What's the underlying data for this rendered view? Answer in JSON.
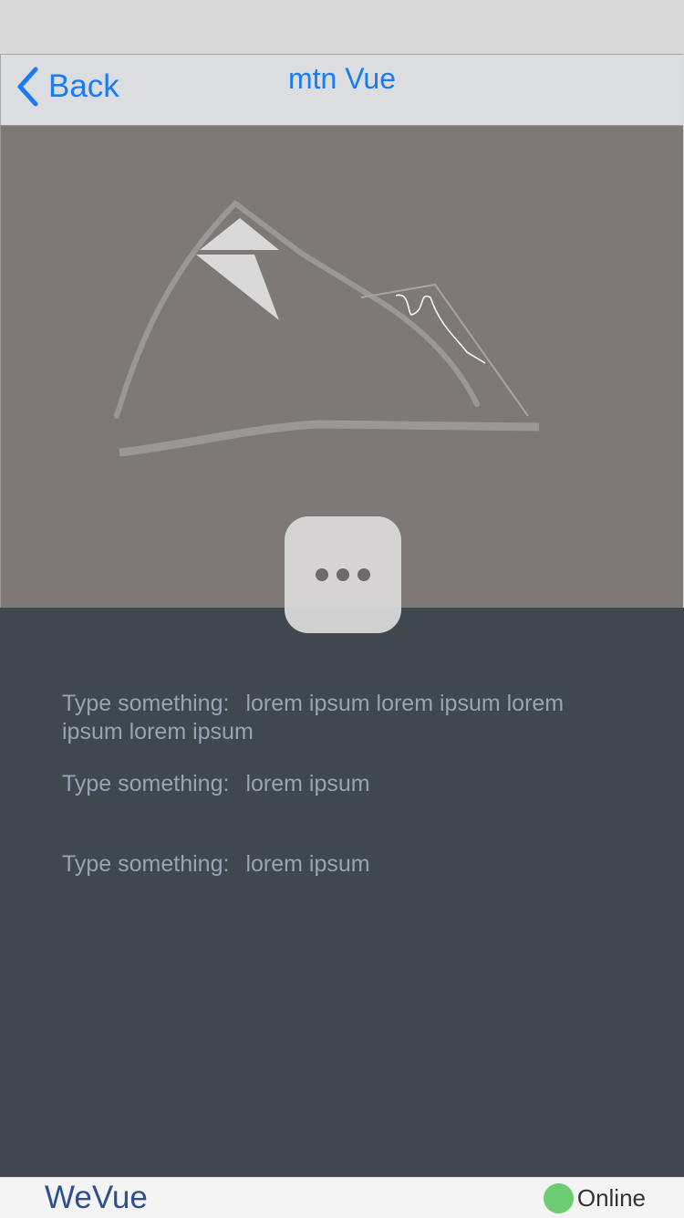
{
  "app": {
    "brand": "WeVue",
    "status_label": "Online",
    "colors": {
      "accent": "#1a7cf4",
      "brand": "#2d4f93",
      "online": "#6dcc72",
      "content_bg": "#3f474f"
    }
  },
  "nav": {
    "back_label": "Back",
    "back_icon": "chevron-left-icon",
    "title": "mtn Vue"
  },
  "hero": {
    "image": "mountain-sketch",
    "more_icon": "ellipsis-icon"
  },
  "details": [
    {
      "label": "Type something:",
      "value": "lorem ipsum lorem ipsum lorem ipsum lorem ipsum"
    },
    {
      "label": "Type something:",
      "value": "lorem ipsum"
    },
    {
      "label": "Type something:",
      "value": "lorem ipsum"
    }
  ]
}
